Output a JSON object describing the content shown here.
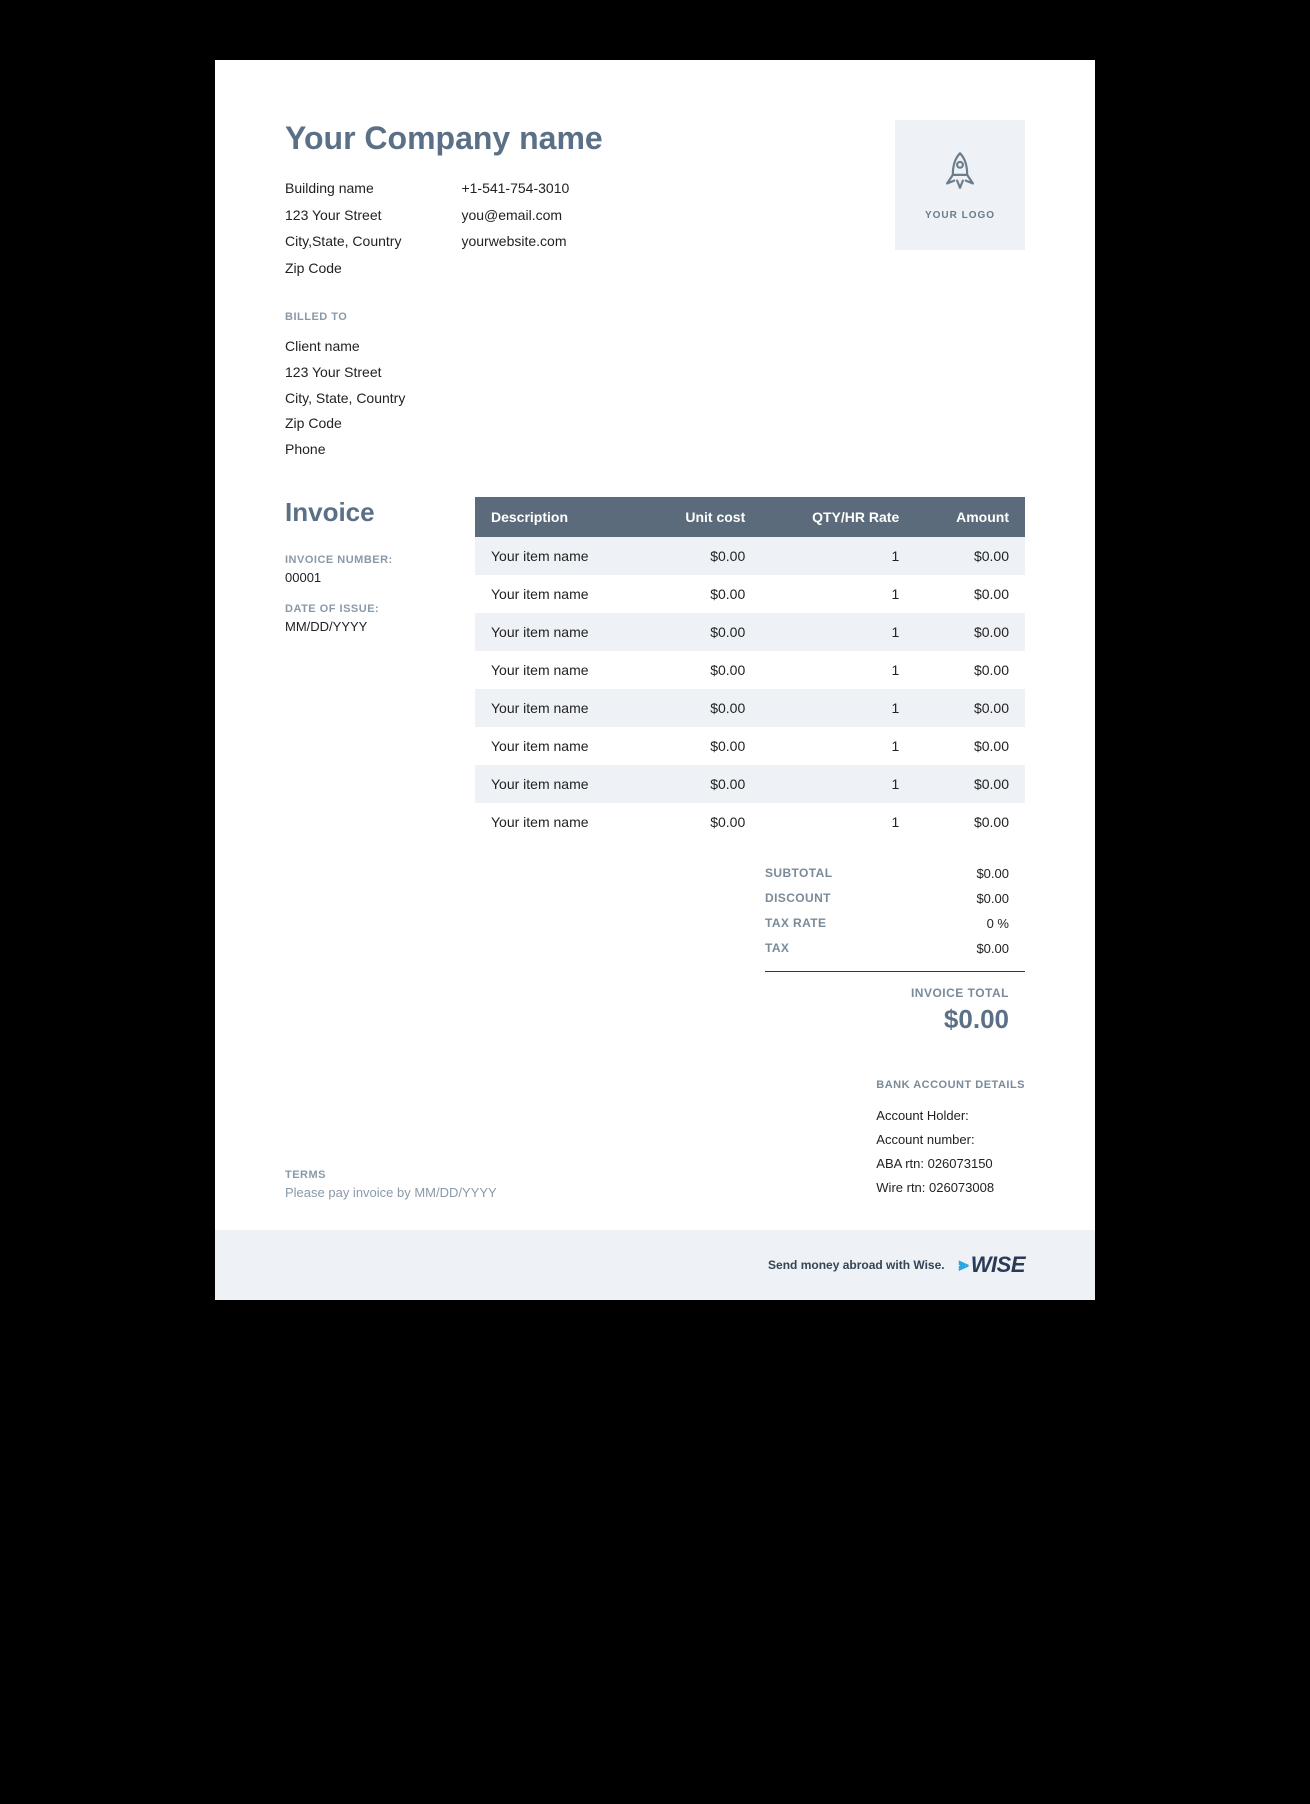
{
  "company": {
    "name": "Your Company name",
    "address": {
      "building": "Building name",
      "street": "123 Your Street",
      "city_line": "City,State, Country",
      "zip": "Zip Code"
    },
    "contact": {
      "phone": "+1-541-754-3010",
      "email": "you@email.com",
      "website": "yourwebsite.com"
    },
    "logo_label": "YOUR LOGO"
  },
  "billed_to": {
    "label": "BILLED TO",
    "name": "Client name",
    "street": "123 Your Street",
    "city_line": "City, State, Country",
    "zip": "Zip Code",
    "phone": "Phone"
  },
  "invoice": {
    "title": "Invoice",
    "number_label": "INVOICE NUMBER:",
    "number": "00001",
    "date_label": "DATE OF ISSUE:",
    "date": "MM/DD/YYYY"
  },
  "columns": {
    "description": "Description",
    "unit_cost": "Unit cost",
    "qty": "QTY/HR Rate",
    "amount": "Amount"
  },
  "items": [
    {
      "desc": "Your item name",
      "unit": "$0.00",
      "qty": "1",
      "amount": "$0.00"
    },
    {
      "desc": "Your item name",
      "unit": "$0.00",
      "qty": "1",
      "amount": "$0.00"
    },
    {
      "desc": "Your item name",
      "unit": "$0.00",
      "qty": "1",
      "amount": "$0.00"
    },
    {
      "desc": "Your item name",
      "unit": "$0.00",
      "qty": "1",
      "amount": "$0.00"
    },
    {
      "desc": "Your item name",
      "unit": "$0.00",
      "qty": "1",
      "amount": "$0.00"
    },
    {
      "desc": "Your item name",
      "unit": "$0.00",
      "qty": "1",
      "amount": "$0.00"
    },
    {
      "desc": "Your item name",
      "unit": "$0.00",
      "qty": "1",
      "amount": "$0.00"
    },
    {
      "desc": "Your item name",
      "unit": "$0.00",
      "qty": "1",
      "amount": "$0.00"
    }
  ],
  "totals": {
    "subtotal_label": "SUBTOTAL",
    "subtotal": "$0.00",
    "discount_label": "DISCOUNT",
    "discount": "$0.00",
    "taxrate_label": "TAX RATE",
    "taxrate": "0 %",
    "tax_label": "TAX",
    "tax": "$0.00",
    "grand_label": "INVOICE TOTAL",
    "grand": "$0.00"
  },
  "bank": {
    "label": "BANK ACCOUNT DETAILS",
    "holder": "Account Holder:",
    "number": "Account number:",
    "aba": "ABA rtn: 026073150",
    "wire": "Wire rtn: 026073008"
  },
  "terms": {
    "label": "TERMS",
    "text": "Please pay invoice by MM/DD/YYYY"
  },
  "footer": {
    "text": "Send money abroad with Wise.",
    "brand": "WISE"
  }
}
